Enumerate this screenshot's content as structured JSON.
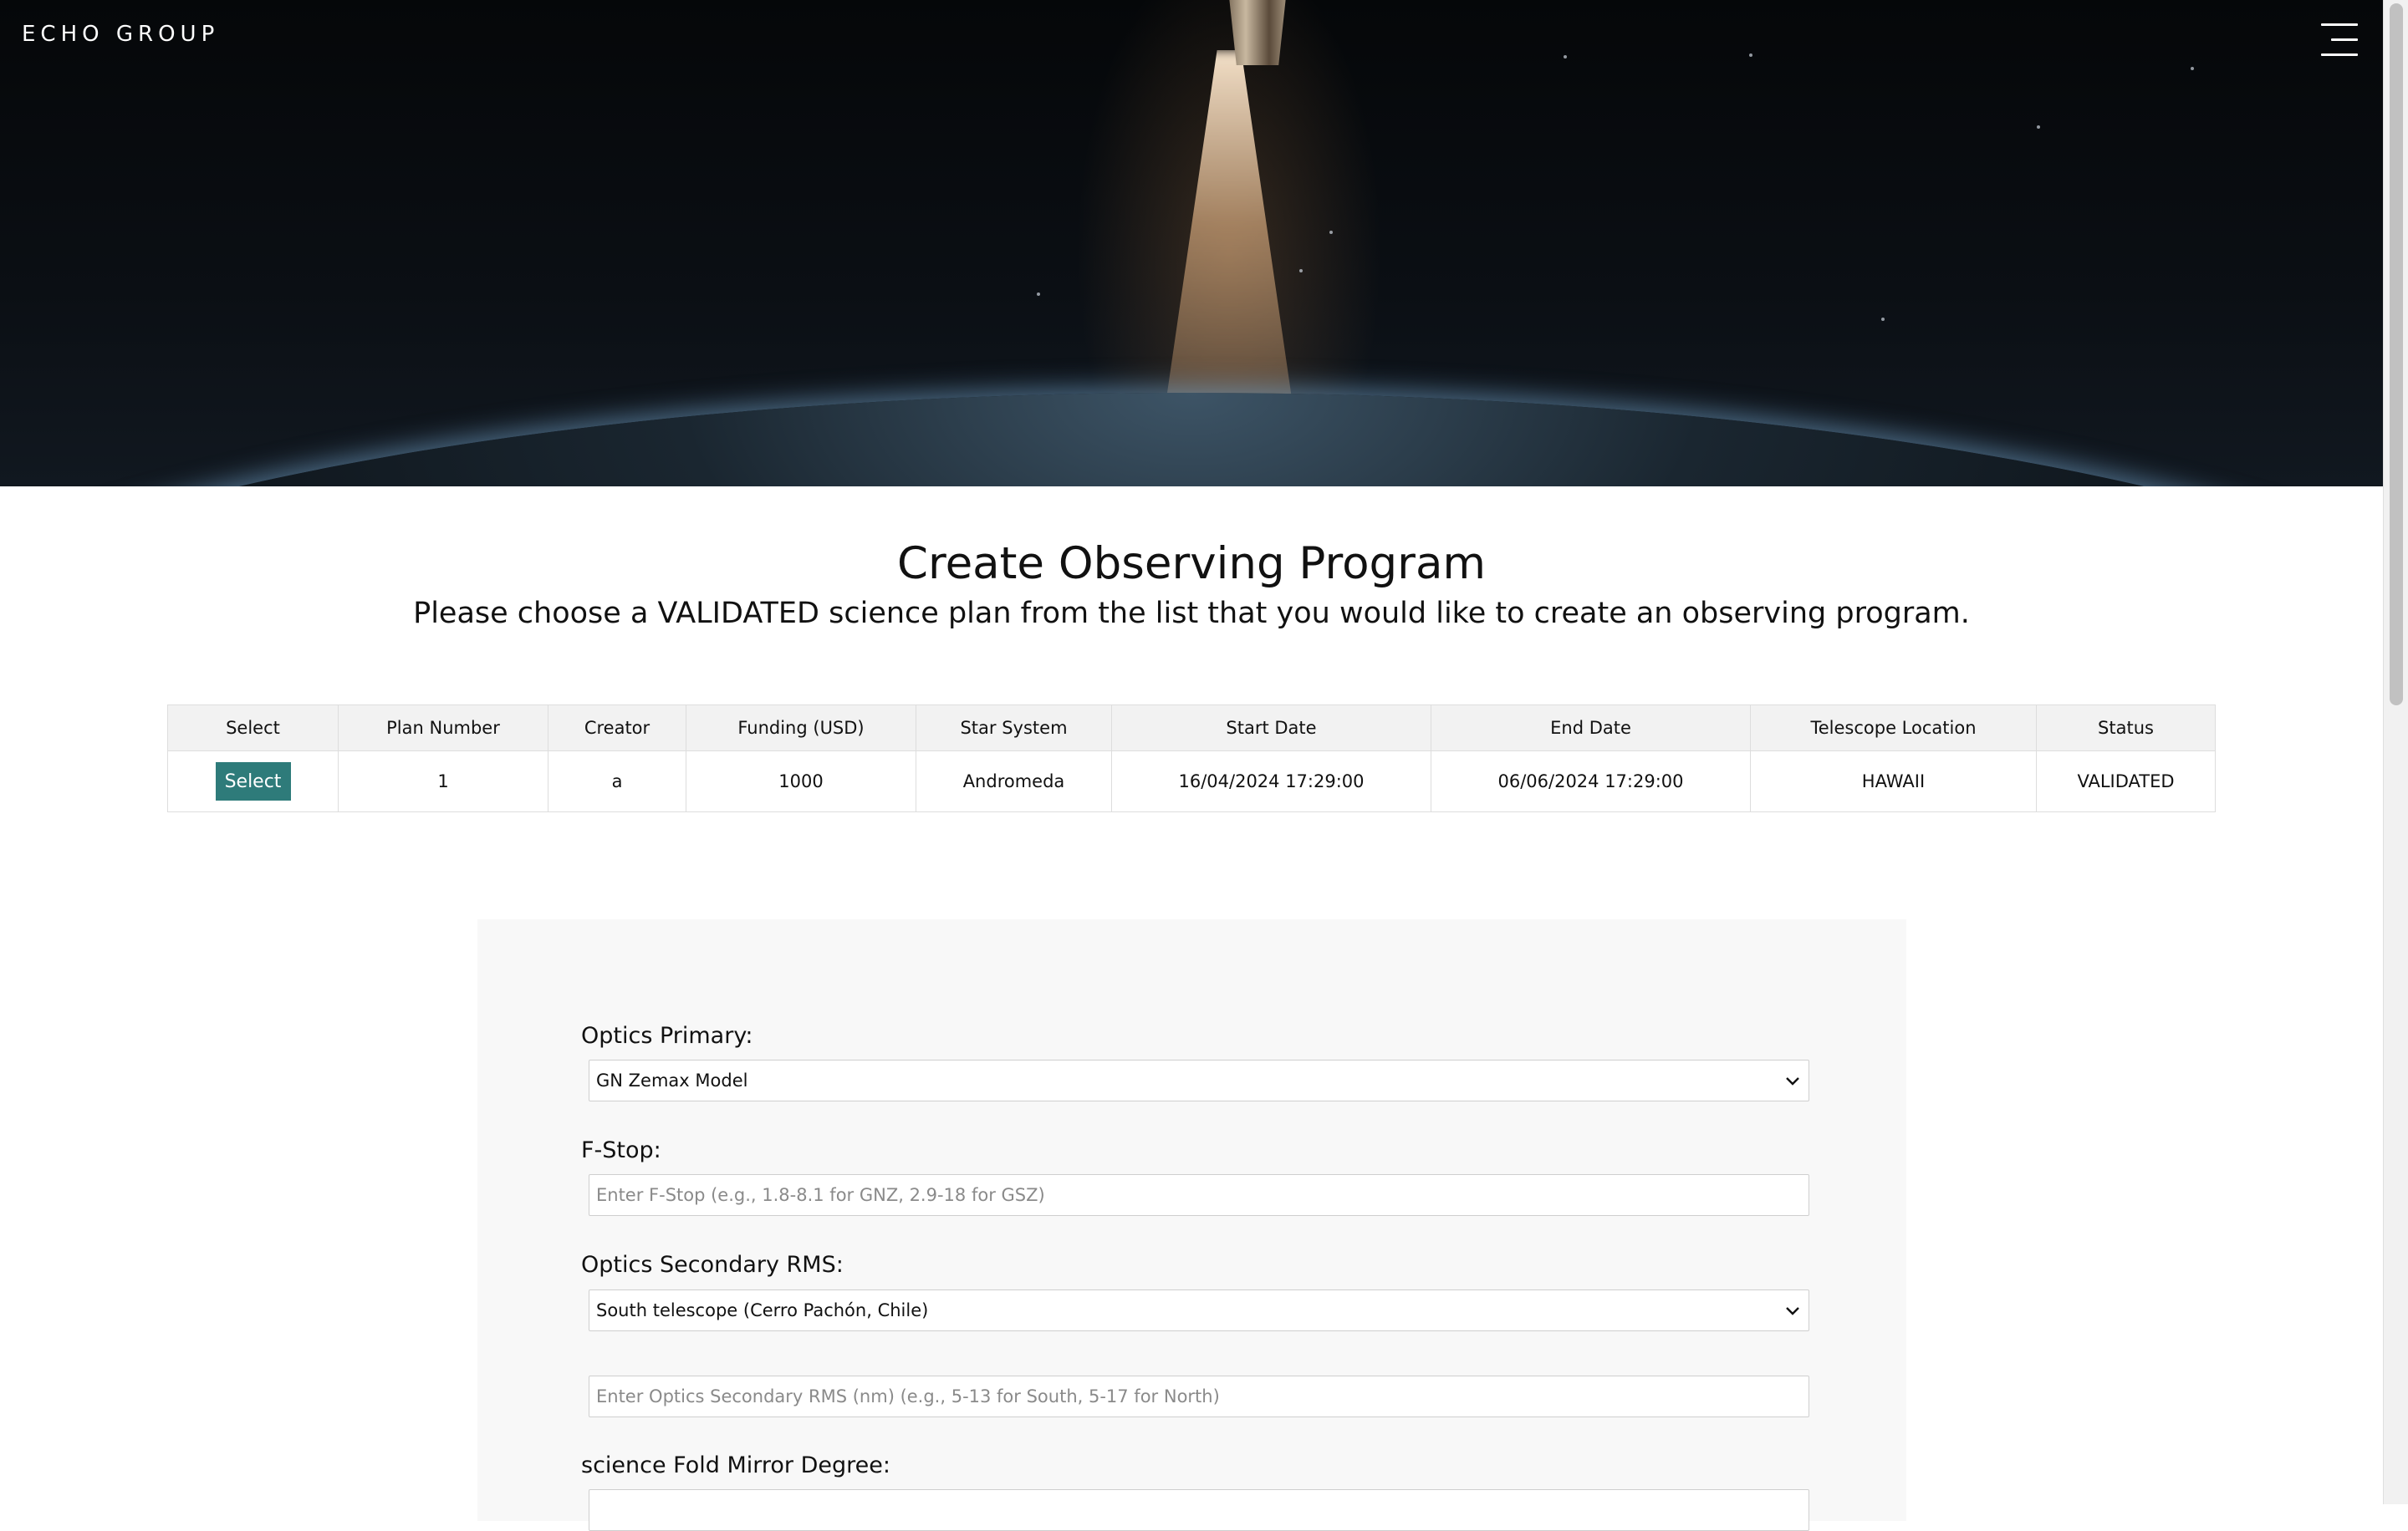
{
  "header": {
    "brand": "ECHO GROUP",
    "menu_icon": "hamburger-menu-icon"
  },
  "page": {
    "title": "Create Observing Program",
    "subtitle": "Please choose a VALIDATED science plan from the list that you would like to create an observing program."
  },
  "plans_table": {
    "columns": [
      "Select",
      "Plan Number",
      "Creator",
      "Funding (USD)",
      "Star System",
      "Start Date",
      "End Date",
      "Telescope Location",
      "Status"
    ],
    "rows": [
      {
        "select_label": "Select",
        "plan_number": "1",
        "creator": "a",
        "funding": "1000",
        "star_system": "Andromeda",
        "start_date": "16/04/2024 17:29:00",
        "end_date": "06/06/2024 17:29:00",
        "telescope_location": "HAWAII",
        "status": "VALIDATED"
      }
    ]
  },
  "form": {
    "optics_primary": {
      "label": "Optics Primary:",
      "value": "GN Zemax Model"
    },
    "f_stop": {
      "label": "F-Stop:",
      "placeholder": "Enter F-Stop (e.g., 1.8-8.1 for GNZ, 2.9-18 for GSZ)"
    },
    "optics_secondary": {
      "label": "Optics Secondary RMS:",
      "value": "South telescope (Cerro Pachón, Chile)",
      "placeholder": "Enter Optics Secondary RMS (nm) (e.g., 5-13 for South, 5-17 for North)"
    },
    "science_fold": {
      "label": "science Fold Mirror Degree:"
    }
  },
  "colors": {
    "select_button": "#2e7b7a",
    "panel_bg": "#f8f8f8",
    "table_header_bg": "#f2f2f2"
  }
}
